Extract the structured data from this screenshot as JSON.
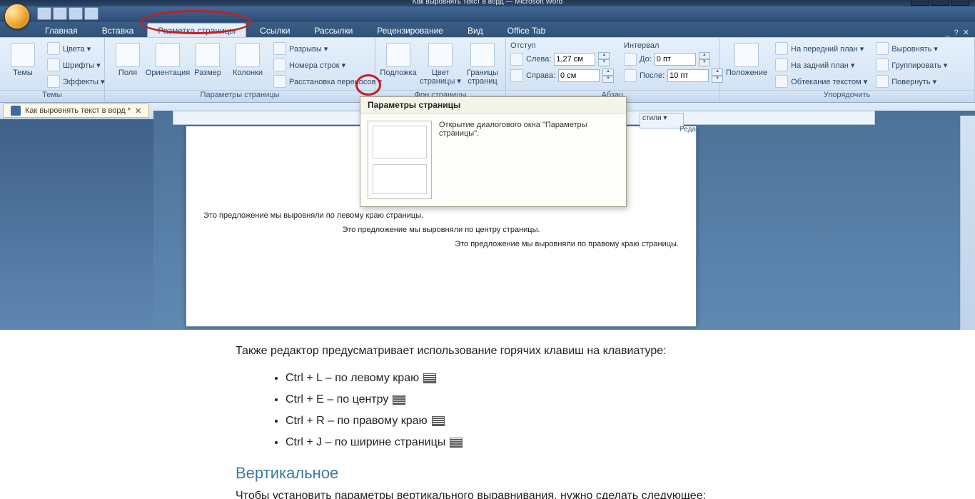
{
  "titlebar": {
    "text": "Как выровнять текст в ворд — Microsoft Word"
  },
  "tabs": {
    "items": [
      "Главная",
      "Вставка",
      "Разметка страницы",
      "Ссылки",
      "Рассылки",
      "Рецензирование",
      "Вид",
      "Office Tab"
    ],
    "help_min": "_",
    "help_close": "✕",
    "help_q": "?"
  },
  "ribbon": {
    "themes": {
      "caption": "Темы",
      "main": "Темы",
      "colors": "Цвета ▾",
      "fonts": "Шрифты ▾",
      "effects": "Эффекты ▾"
    },
    "pagesetup": {
      "caption": "Параметры страницы",
      "fields": "Поля",
      "orient": "Ориентация",
      "size": "Размер",
      "columns": "Колонки",
      "breaks": "Разрывы ▾",
      "linenum": "Номера строк ▾",
      "hyphen": "Расстановка переносов ▾",
      "breaks_pre": "⎘",
      "linenum_pre": "№",
      "hyphen_pre": "bᵃ"
    },
    "pagebg": {
      "caption": "Фон страницы",
      "watermark": "Подложка",
      "pagecolor": "Цвет\nстраницы ▾",
      "borders": "Границы\nстраниц"
    },
    "paragraph": {
      "caption": "Абзац",
      "indent": "Отступ",
      "left_l": "Слева:",
      "left_v": "1,27 см",
      "right_l": "Справа:",
      "right_v": "0 см",
      "spacing": "Интервал",
      "before_l": "До:",
      "before_v": "0 пт",
      "after_l": "После:",
      "after_v": "10 пт"
    },
    "arrange": {
      "caption": "Упорядочить",
      "position": "Положение",
      "front": "На передний план ▾",
      "back": "На задний план ▾",
      "wrap": "Обтекание текстом ▾",
      "align": "Выровнять ▾",
      "group": "Группировать ▾",
      "rotate": "Повернуть ▾"
    }
  },
  "tooltip": {
    "title": "Параметры страницы",
    "text": "Открытие диалогового окна \"Параметры страницы\"."
  },
  "doctab": {
    "label": "Как выровнять текст в ворд *",
    "close": "✕"
  },
  "styles": {
    "label": "стили ▾",
    "redak": "Реда"
  },
  "page": {
    "p1": "Это предложение мы выровняли по левому краю страницы.",
    "p2": "Это предложение мы выровняли по центру страницы.",
    "p3": "Это предложение мы выровняли по правому краю страницы."
  },
  "article": {
    "intro": "Также редактор предусматривает использование горячих клавиш на клавиатуре:",
    "li1": "Ctrl + L – по левому краю",
    "li2": "Ctrl + E – по центру",
    "li3": "Ctrl + R – по правому краю",
    "li4": "Ctrl + J – по ширине страницы",
    "h3": "Вертикальное",
    "p2": "Чтобы установить параметры вертикального выравнивания, нужно сделать следующее:"
  }
}
